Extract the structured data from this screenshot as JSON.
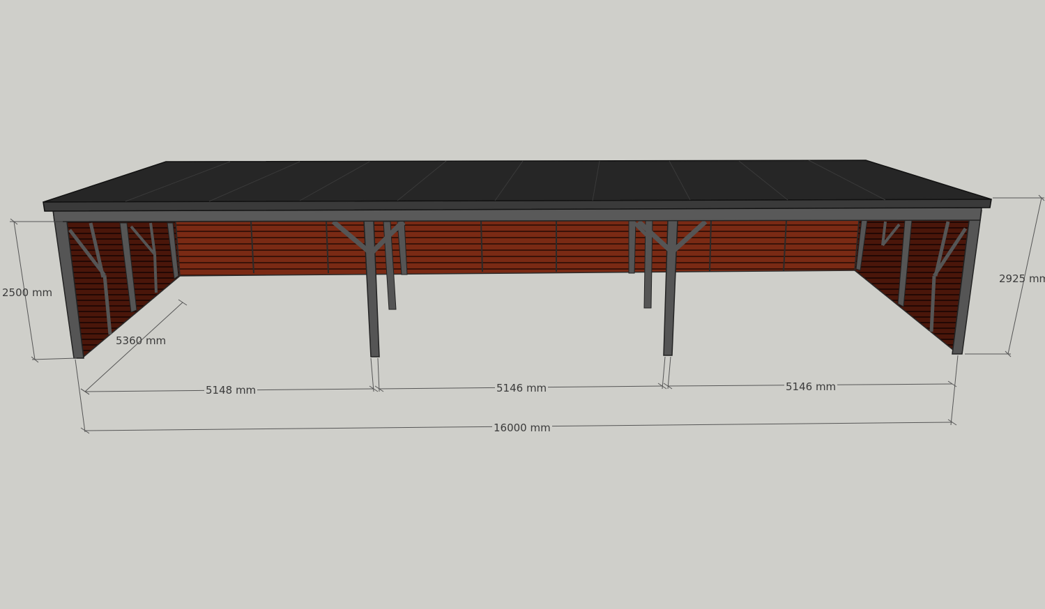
{
  "model": {
    "colors": {
      "background": "#cfcfca",
      "roof": "#2b2b2b",
      "frame": "#4a4a4a",
      "cladding": "#7a2a14",
      "dimension_line": "#555555"
    }
  },
  "dimensions": {
    "height_front": "2500 mm",
    "height_total": "2925 mm",
    "depth": "5360 mm",
    "bay_1": "5148 mm",
    "bay_2": "5146 mm",
    "bay_3": "5146 mm",
    "total_length": "16000 mm"
  }
}
